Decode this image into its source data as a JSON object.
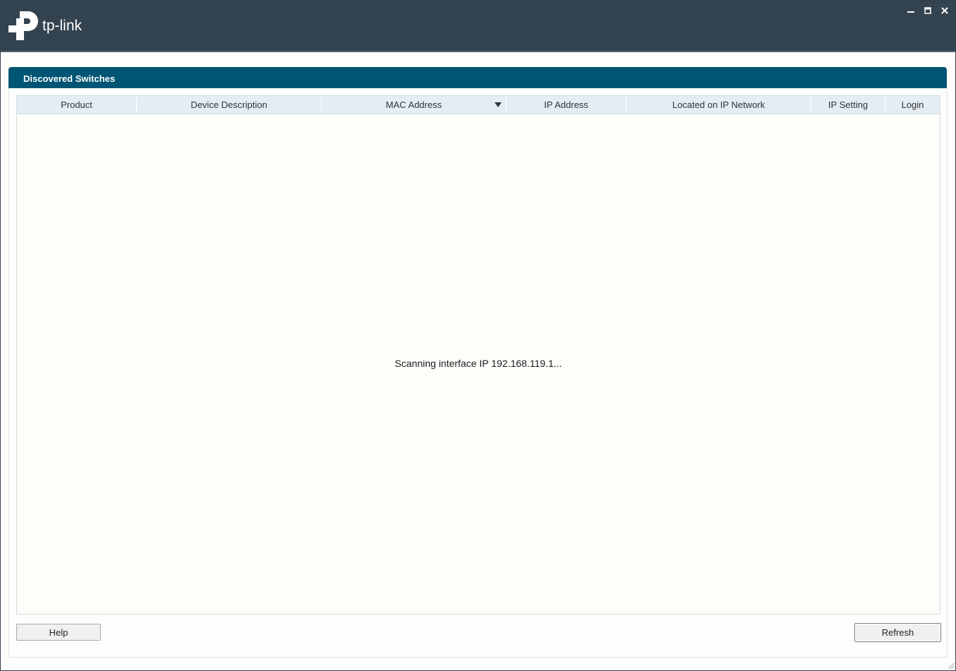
{
  "window": {
    "brand": "tp-link",
    "controls": {
      "minimize": "–",
      "maximize": "■",
      "close": "✕"
    }
  },
  "panel": {
    "title": "Discovered Switches"
  },
  "table": {
    "columns": [
      {
        "label": "Product"
      },
      {
        "label": "Device Description"
      },
      {
        "label": "MAC Address"
      },
      {
        "label": "IP Address"
      },
      {
        "label": "Located on IP Network"
      },
      {
        "label": "IP Setting"
      },
      {
        "label": "Login"
      }
    ],
    "sorted_column": "MAC Address",
    "sort_direction": "descending",
    "status": "Scanning interface IP 192.168.119.1..."
  },
  "buttons": {
    "help": "Help",
    "refresh": "Refresh"
  },
  "colors": {
    "titlebar": "#33434f",
    "panel_header": "#005574",
    "table_header": "#e4edf3"
  }
}
